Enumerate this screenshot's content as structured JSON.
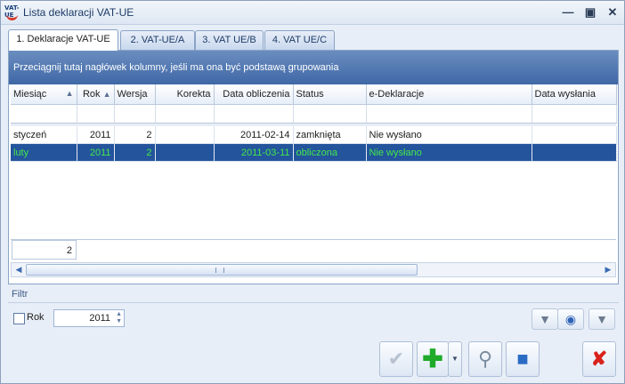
{
  "window": {
    "title": "Lista deklaracji VAT-UE",
    "icon_badge": "VAT-UE"
  },
  "tabs": [
    {
      "label": "1. Deklaracje VAT-UE"
    },
    {
      "label": "2. VAT-UE/A"
    },
    {
      "label": "3. VAT UE/B"
    },
    {
      "label": "4. VAT UE/C"
    }
  ],
  "group_bar": "Przeciągnij tutaj nagłówek kolumny, jeśli ma ona być podstawą grupowania",
  "columns": {
    "miesiac": "Miesiąc",
    "rok": "Rok",
    "wersja": "Wersja",
    "korekta": "Korekta",
    "data_obliczenia": "Data obliczenia",
    "status": "Status",
    "e_deklaracje": "e-Deklaracje",
    "data_wyslania": "Data wysłania"
  },
  "rows": [
    {
      "miesiac": "styczeń",
      "rok": "2011",
      "wersja": "2",
      "korekta": "",
      "data_obliczenia": "2011-02-14",
      "status": "zamknięta",
      "e_deklaracje": "Nie wysłano",
      "data_wyslania": ""
    },
    {
      "miesiac": "luty",
      "rok": "2011",
      "wersja": "2",
      "korekta": "",
      "data_obliczenia": "2011-03-11",
      "status": "obliczona",
      "e_deklaracje": "Nie wysłano",
      "data_wyslania": ""
    }
  ],
  "selected_row": 1,
  "record_count": "2",
  "filter": {
    "section_label": "Filtr",
    "year_label": "Rok",
    "year_value": "2011",
    "year_checked": false
  },
  "colors": {
    "selection_bg": "#24549c",
    "selection_text": "#43e84b",
    "group_bar": "#3f68a6"
  }
}
